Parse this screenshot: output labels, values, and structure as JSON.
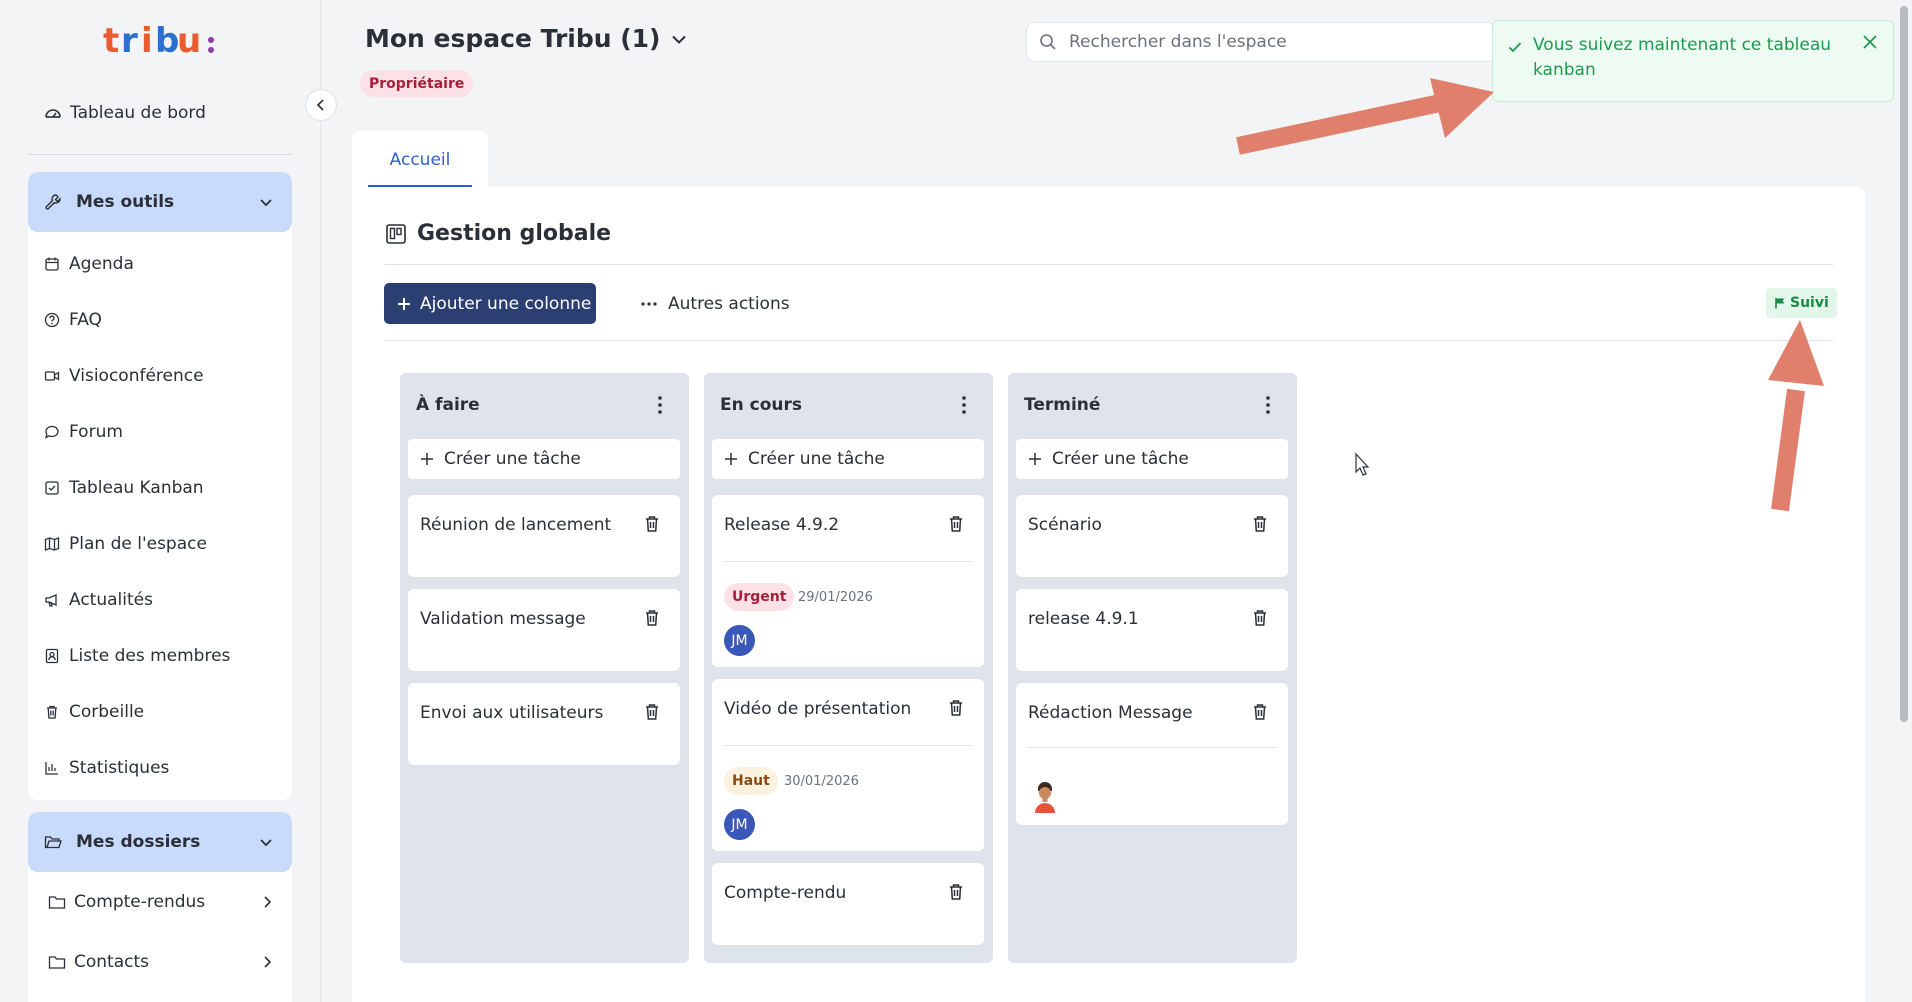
{
  "sidebar": {
    "dashboard_label": "Tableau de bord",
    "tools_group": {
      "label": "Mes outils",
      "items": [
        {
          "label": "Agenda",
          "icon": "calendar-icon"
        },
        {
          "label": "FAQ",
          "icon": "help-circle-icon"
        },
        {
          "label": "Visioconférence",
          "icon": "video-icon"
        },
        {
          "label": "Forum",
          "icon": "chat-bubble-icon"
        },
        {
          "label": "Tableau Kanban",
          "icon": "check-square-icon"
        },
        {
          "label": "Plan de l'espace",
          "icon": "map-icon"
        },
        {
          "label": "Actualités",
          "icon": "megaphone-icon"
        },
        {
          "label": "Liste des membres",
          "icon": "contact-card-icon"
        },
        {
          "label": "Corbeille",
          "icon": "trash-icon"
        },
        {
          "label": "Statistiques",
          "icon": "bar-chart-icon"
        }
      ]
    },
    "folders_group": {
      "label": "Mes dossiers",
      "items": [
        {
          "label": "Compte-rendus"
        },
        {
          "label": "Contacts"
        }
      ]
    }
  },
  "header": {
    "space_title": "Mon espace Tribu (1)",
    "role_badge": "Propriétaire",
    "search_placeholder": "Rechercher dans l'espace"
  },
  "toast": {
    "message": "Vous suivez maintenant ce tableau kanban"
  },
  "tabs": [
    {
      "label": "Accueil",
      "active": true
    }
  ],
  "board": {
    "title": "Gestion globale",
    "add_column_label": "Ajouter une colonne",
    "more_actions_label": "Autres actions",
    "follow_badge": "Suivi",
    "create_task_label": "Créer une tâche",
    "columns": [
      {
        "title": "À faire",
        "cards": [
          {
            "title": "Réunion de lancement"
          },
          {
            "title": "Validation message"
          },
          {
            "title": "Envoi aux utilisateurs"
          }
        ]
      },
      {
        "title": "En cours",
        "cards": [
          {
            "title": "Release 4.9.2",
            "priority": "Urgent",
            "date": "29/01/2026",
            "assignee": "JM"
          },
          {
            "title": "Vidéo de présentation",
            "priority": "Haut",
            "date": "30/01/2026",
            "assignee": "JM"
          },
          {
            "title": "Compte-rendu"
          }
        ]
      },
      {
        "title": "Terminé",
        "cards": [
          {
            "title": "Scénario"
          },
          {
            "title": "release 4.9.1"
          },
          {
            "title": "Rédaction Message",
            "assignee_avatar": "person-avatar-icon"
          }
        ]
      }
    ]
  },
  "colors": {
    "primary_button": "#2b3f72",
    "accent_blue": "#2d5fd3",
    "group_header": "#c9dbfa",
    "success_green": "#1c9a4f",
    "urgent_badge": "#a3213a",
    "annotation_arrow": "#e0806c"
  }
}
